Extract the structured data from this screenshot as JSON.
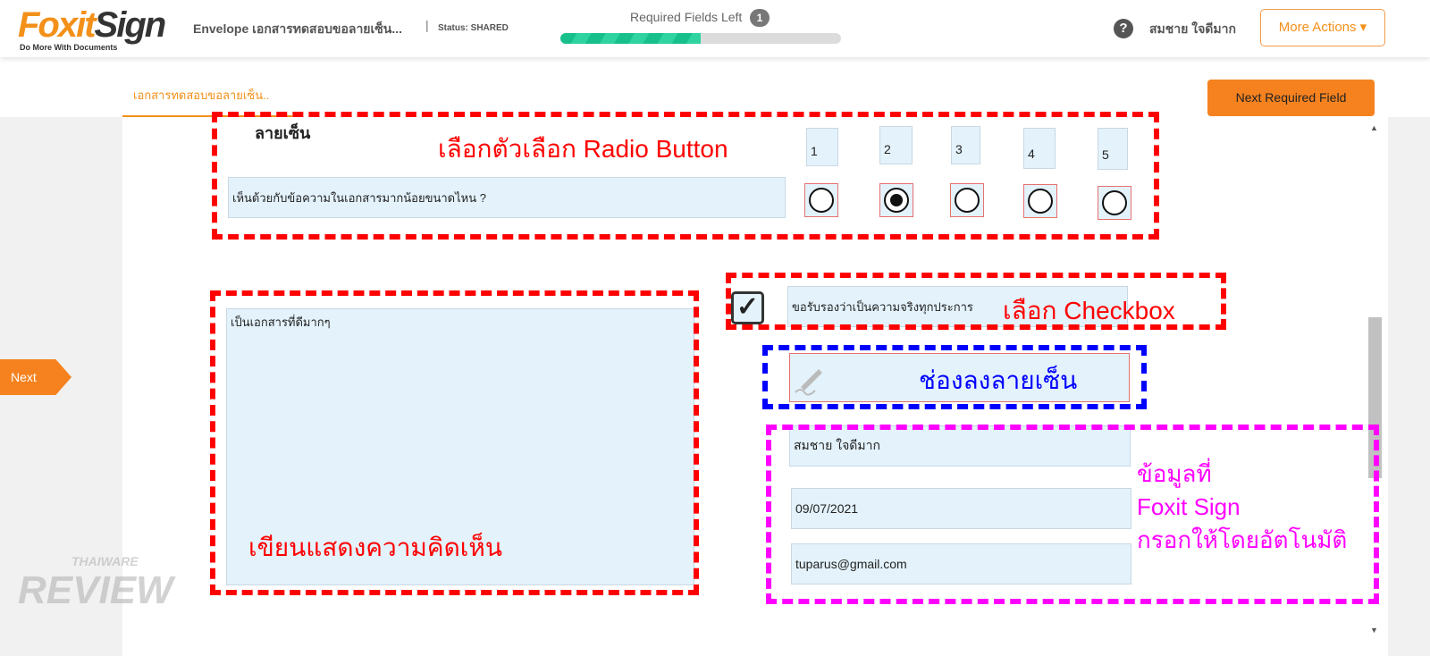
{
  "header": {
    "logo": "FoxitSign",
    "logo_tagline": "Do More With Documents",
    "envelope_title": "Envelope เอกสารทดสอบขอลายเซ็น...",
    "separator": "|",
    "status": "Status: SHARED",
    "required_label": "Required Fields Left",
    "required_count": "1",
    "progress_percent": 50,
    "help_icon": "?",
    "user_name": "สมชาย ใจดีมาก",
    "more_actions": "More Actions ▾"
  },
  "subbar": {
    "doc_tab": "เอกสารทดสอบขอลายเซ็น..",
    "next_required": "Next Required Field",
    "next": "Next"
  },
  "form": {
    "section_title": "ลายเซ็น",
    "scale_labels": [
      "1",
      "2",
      "3",
      "4",
      "5"
    ],
    "question": "เห็นด้วยกับข้อความในเอกสารมากน้อยขนาดไหน ?",
    "selected_option": "2",
    "comment": "เป็นเอกสารที่ดีมากๆ",
    "checkbox_checked": true,
    "checkbox_label": "ขอรับรองว่าเป็นความจริงทุกประการ",
    "name": "สมชาย ใจดีมาก",
    "date": "09/07/2021",
    "email": "tuparus@gmail.com"
  },
  "annotations": {
    "radio": "เลือกตัวเลือก Radio Button",
    "checkbox": "เลือก Checkbox",
    "comment": "เขียนแสดงความคิดเห็น",
    "signature": "ช่องลงลายเซ็น",
    "auto_line1": "ข้อมูลที่",
    "auto_line2": "Foxit Sign",
    "auto_line3": "กรอกให้โดยอัตโนมัติ"
  },
  "watermark": {
    "line1": "THAIWARE",
    "line2": "REVIEW"
  },
  "colors": {
    "accent": "#f5821f",
    "field": "#e3f2fb",
    "red": "#ff0000",
    "blue": "#0000ff",
    "magenta": "#ff00ff"
  }
}
